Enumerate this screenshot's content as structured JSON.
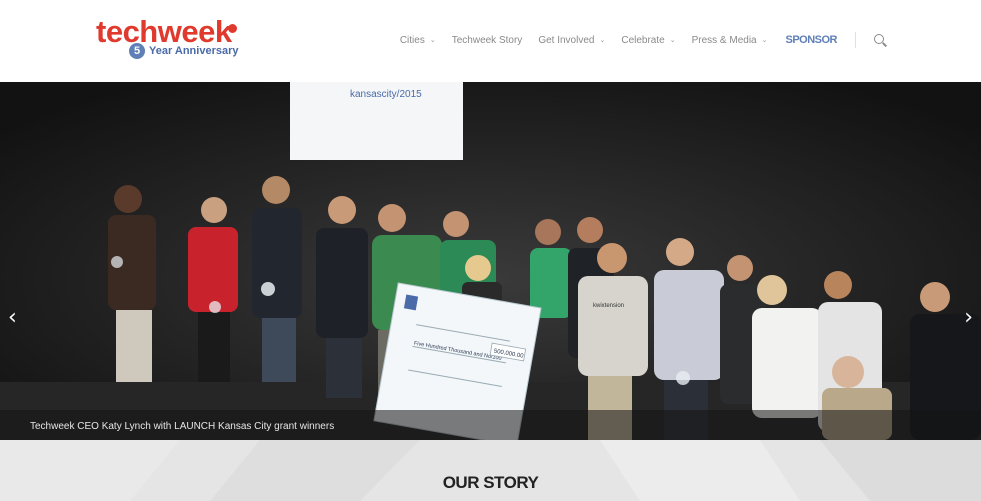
{
  "brand": {
    "wordmark": "techweek",
    "badge_number": "5",
    "tagline": "Year Anniversary",
    "color": "#e03a2e",
    "accent": "#5f7fb7"
  },
  "nav": {
    "items": [
      {
        "label": "Cities",
        "has_dropdown": true
      },
      {
        "label": "Techweek Story",
        "has_dropdown": false
      },
      {
        "label": "Get Involved",
        "has_dropdown": true
      },
      {
        "label": "Celebrate",
        "has_dropdown": true
      },
      {
        "label": "Press & Media",
        "has_dropdown": true
      }
    ],
    "sponsor_label": "SPONSOR",
    "search_icon": "search-icon"
  },
  "slider": {
    "caption": "Techweek CEO Katy Lynch with LAUNCH Kansas City grant winners",
    "prev_icon": "chevron-left-icon",
    "next_icon": "chevron-right-icon",
    "banner_text": "kansascity/2015",
    "check_text": "Five Hundred Thousand and No/100",
    "check_amount": "500,000.00",
    "shirt_text": "kwixtension"
  },
  "story": {
    "title": "OUR STORY"
  }
}
